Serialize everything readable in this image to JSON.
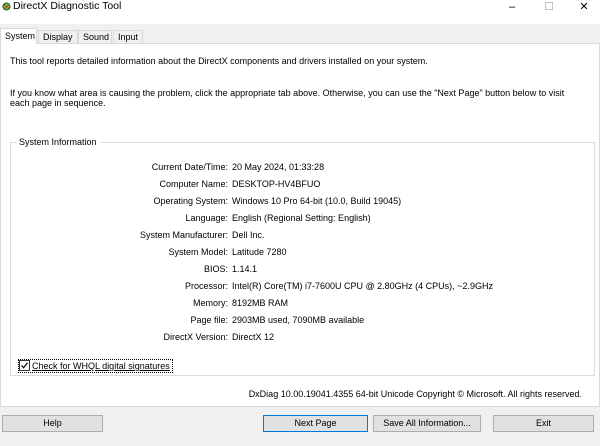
{
  "window": {
    "title": "DirectX Diagnostic Tool",
    "controls": {
      "minimize": "–",
      "maximize": "☐",
      "close": "✕"
    }
  },
  "tabs": [
    {
      "label": "System",
      "active": true
    },
    {
      "label": "Display",
      "active": false
    },
    {
      "label": "Sound",
      "active": false
    },
    {
      "label": "Input",
      "active": false
    }
  ],
  "intro": {
    "line1": "This tool reports detailed information about the DirectX components and drivers installed on your system.",
    "line2": "If you know what area is causing the problem, click the appropriate tab above.  Otherwise, you can use the \"Next Page\" button below to visit each page in sequence."
  },
  "system_info": {
    "title": "System Information",
    "rows": [
      {
        "label": "Current Date/Time:",
        "value": "20 May 2024, 01:33:28"
      },
      {
        "label": "Computer Name:",
        "value": "DESKTOP-HV4BFUO"
      },
      {
        "label": "Operating System:",
        "value": "Windows 10 Pro 64-bit (10.0, Build 19045)"
      },
      {
        "label": "Language:",
        "value": "English (Regional Setting: English)"
      },
      {
        "label": "System Manufacturer:",
        "value": "Dell Inc."
      },
      {
        "label": "System Model:",
        "value": "Latitude 7280"
      },
      {
        "label": "BIOS:",
        "value": "1.14.1"
      },
      {
        "label": "Processor:",
        "value": "Intel(R) Core(TM) i7-7600U CPU @ 2.80GHz (4 CPUs), ~2.9GHz"
      },
      {
        "label": "Memory:",
        "value": "8192MB RAM"
      },
      {
        "label": "Page file:",
        "value": "2903MB used, 7090MB available"
      },
      {
        "label": "DirectX Version:",
        "value": "DirectX 12"
      }
    ]
  },
  "whql_check": {
    "label": "Check for WHQL digital signatures",
    "checked": true
  },
  "footer": "DxDiag 10.00.19041.4355 64-bit Unicode  Copyright © Microsoft. All rights reserved.",
  "buttons": {
    "help": "Help",
    "next_page": "Next Page",
    "save_all": "Save All Information...",
    "exit": "Exit"
  },
  "colors": {
    "accent": "#0078d7",
    "window_bg": "#f0f0f0",
    "panel_bg": "#ffffff"
  },
  "icons": {
    "app": "directx-icon",
    "check": "checkmark-icon"
  }
}
